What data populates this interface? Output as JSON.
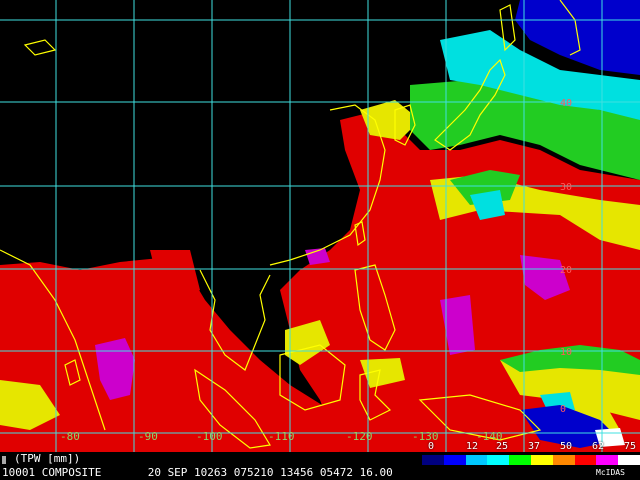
{
  "product": {
    "title": "(TPW [mm])",
    "footer": "10001 COMPOSITE       20 SEP 10263 075210 13456 05472 16.00",
    "credit": "McIDAS"
  },
  "legend": {
    "ticks": [
      "0",
      "12",
      "25",
      "37",
      "50",
      "62",
      "75"
    ],
    "colors": [
      "#000080",
      "#0000ff",
      "#00c8ff",
      "#00ffff",
      "#00ff00",
      "#ffff00",
      "#ff8800",
      "#ff0000",
      "#ff00ff",
      "#ffffff"
    ]
  },
  "grid": {
    "longitudes": [
      "80",
      "90",
      "100",
      "110",
      "120",
      "130",
      "140"
    ],
    "latitudes": [
      "0",
      "10",
      "20",
      "30",
      "40"
    ]
  },
  "palette": {
    "land": "#000000",
    "grid": "#40e0e0",
    "coast": "#ffff00",
    "tpw_high": "#e00000",
    "tpw_peak": "#cc00cc",
    "tpw_mid": "#e6e600",
    "tpw_low": "#22cc22",
    "tpw_verylow": "#00e0e0",
    "tpw_min": "#0000cc"
  }
}
